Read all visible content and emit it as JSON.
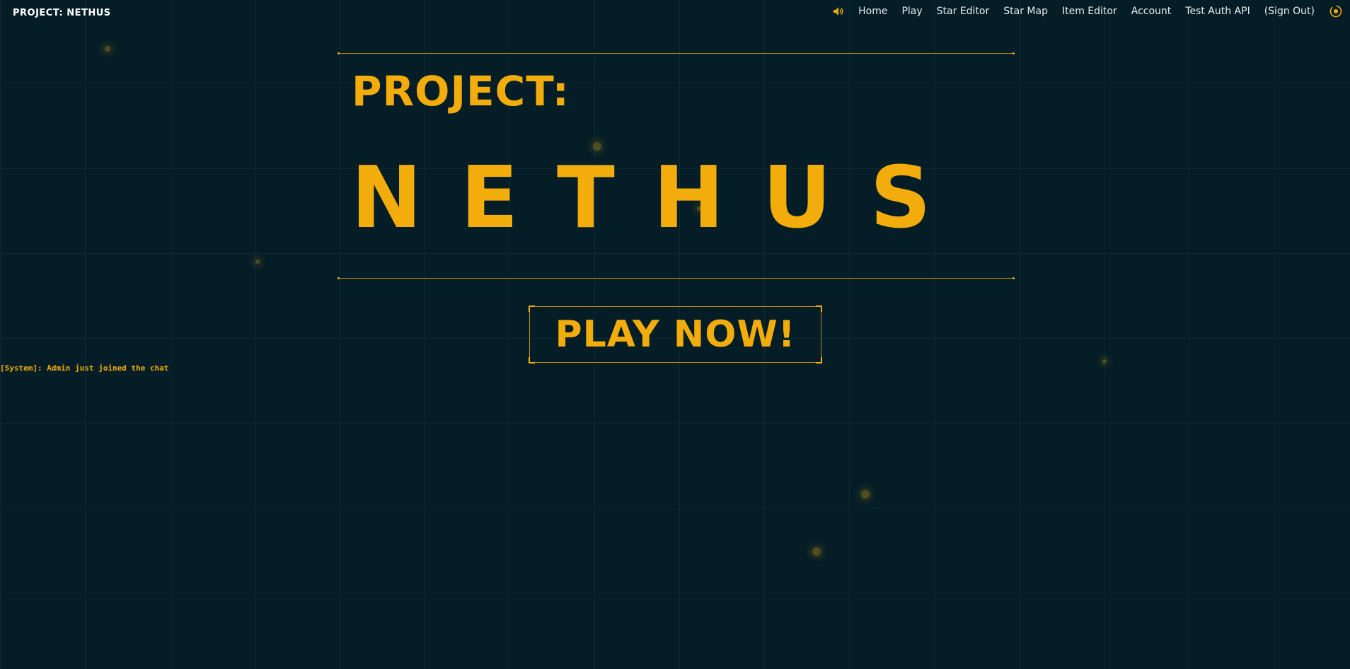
{
  "brand": {
    "logo_text": "PROJECT: NETHUS",
    "accent_color": "#f2ad0c",
    "background_color": "#041d26"
  },
  "nav": {
    "sound_icon": "speaker-icon",
    "links": [
      {
        "label": "Home"
      },
      {
        "label": "Play"
      },
      {
        "label": "Star Editor"
      },
      {
        "label": "Star Map"
      },
      {
        "label": "Item Editor"
      },
      {
        "label": "Account"
      },
      {
        "label": "Test Auth API"
      },
      {
        "label": "(Sign Out)"
      }
    ],
    "theme_icon": "sun-icon"
  },
  "hero": {
    "title_small": "PROJECT:",
    "title_big_letters": [
      "N",
      "E",
      "T",
      "H",
      "U",
      "S"
    ]
  },
  "play_button": {
    "label": "PLAY NOW!"
  },
  "chat": {
    "messages": [
      "[System]: Admin just joined the chat"
    ]
  }
}
